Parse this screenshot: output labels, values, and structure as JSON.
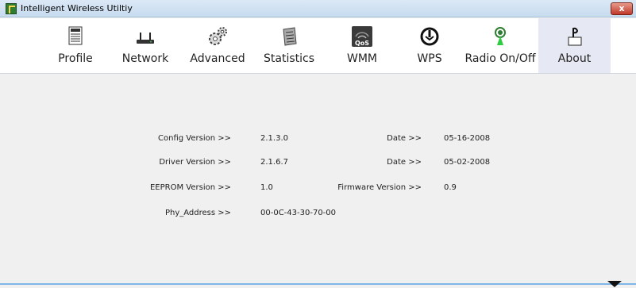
{
  "window": {
    "title": "Intelligent Wireless Utiltiy",
    "close_label": "x"
  },
  "toolbar": {
    "items": [
      {
        "label": "Profile",
        "icon": "profile-icon"
      },
      {
        "label": "Network",
        "icon": "network-icon"
      },
      {
        "label": "Advanced",
        "icon": "advanced-icon"
      },
      {
        "label": "Statistics",
        "icon": "statistics-icon"
      },
      {
        "label": "WMM",
        "icon": "wmm-icon"
      },
      {
        "label": "WPS",
        "icon": "wps-icon"
      },
      {
        "label": "Radio On/Off",
        "icon": "radio-icon"
      },
      {
        "label": "About",
        "icon": "about-icon"
      }
    ],
    "active": "About"
  },
  "about": {
    "config_version_label": "Config Version >>",
    "config_version": "2.1.3.0",
    "config_date_label": "Date >>",
    "config_date": "05-16-2008",
    "driver_version_label": "Driver Version >>",
    "driver_version": "2.1.6.7",
    "driver_date_label": "Date >>",
    "driver_date": "05-02-2008",
    "eeprom_version_label": "EEPROM Version >>",
    "eeprom_version": "1.0",
    "firmware_version_label": "Firmware Version >>",
    "firmware_version": "0.9",
    "phy_address_label": "Phy_Address >>",
    "phy_address": "00-0C-43-30-70-00"
  }
}
